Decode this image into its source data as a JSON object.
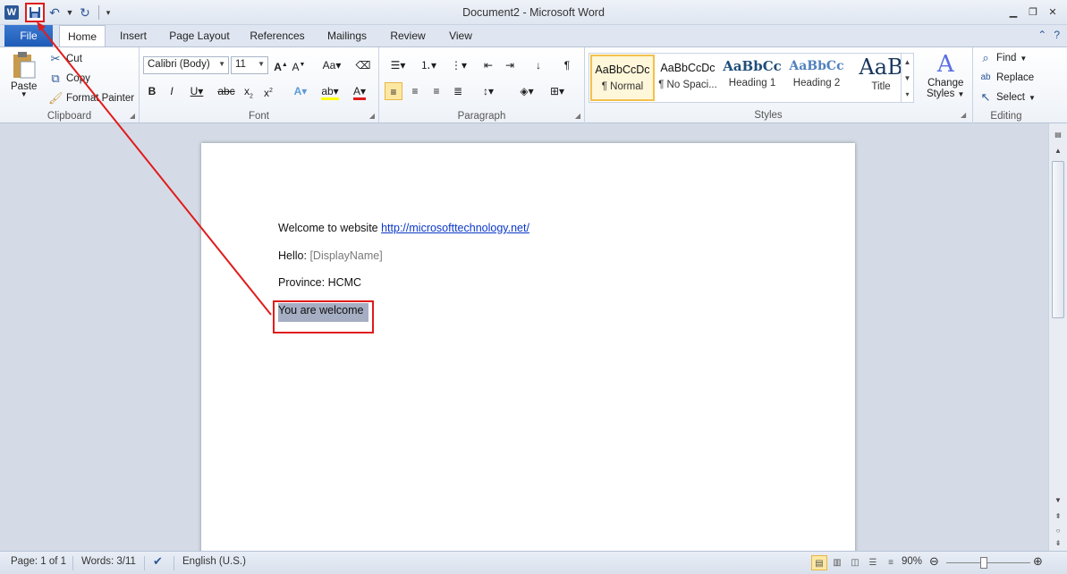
{
  "app": {
    "title": "Document2 - Microsoft Word",
    "logo_letter": "W"
  },
  "tabs": {
    "file": "File",
    "items": [
      "Home",
      "Insert",
      "Page Layout",
      "References",
      "Mailings",
      "Review",
      "View"
    ]
  },
  "ribbon": {
    "clipboard": {
      "paste": "Paste",
      "cut": "Cut",
      "copy": "Copy",
      "format_painter": "Format Painter",
      "label": "Clipboard"
    },
    "font": {
      "family": "Calibri (Body)",
      "size": "11",
      "label": "Font"
    },
    "paragraph": {
      "label": "Paragraph"
    },
    "styles": {
      "items": [
        {
          "sample": "AaBbCcDc",
          "name": "¶ Normal"
        },
        {
          "sample": "AaBbCcDc",
          "name": "¶ No Spaci..."
        },
        {
          "sample": "AaBbCc",
          "name": "Heading 1"
        },
        {
          "sample": "AaBbCc",
          "name": "Heading 2"
        },
        {
          "sample": "AaB",
          "name": "Title"
        }
      ],
      "change_styles_line1": "Change",
      "change_styles_line2": "Styles",
      "label": "Styles"
    },
    "editing": {
      "find": "Find",
      "replace": "Replace",
      "select": "Select",
      "label": "Editing"
    }
  },
  "document": {
    "line1_text": "Welcome to website ",
    "line1_link": "http://microsofttechnology.net/",
    "line2_text": "Hello: ",
    "line2_field": "[DisplayName]",
    "line3_text": "Province: HCMC",
    "line4_text": "You are welcome"
  },
  "status": {
    "page": "Page: 1 of 1",
    "words": "Words: 3/11",
    "language": "English (U.S.)",
    "zoom": "90%"
  },
  "colors": {
    "accent": "#2b5797",
    "annotation": "#e01c1c",
    "selection": "#a5aec3",
    "link": "#0b37c9"
  }
}
